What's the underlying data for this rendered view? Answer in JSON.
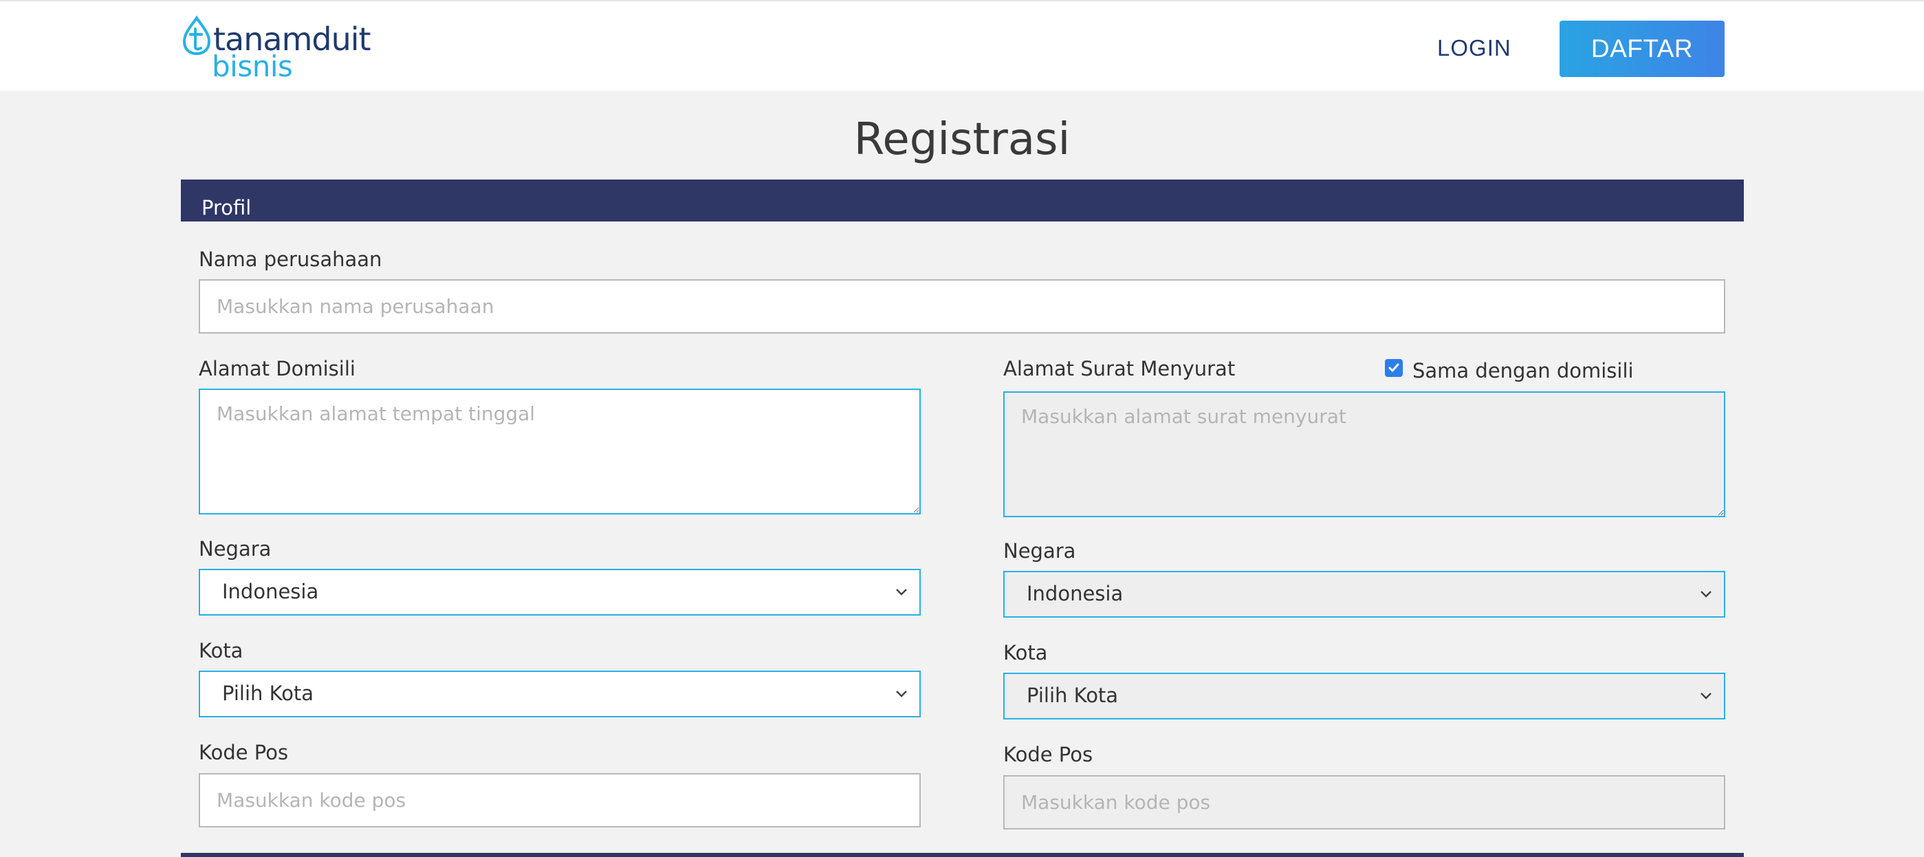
{
  "header": {
    "logo_line1": "tanamduit",
    "logo_line2": "bisnis",
    "login_label": "LOGIN",
    "daftar_label": "DAFTAR"
  },
  "page_title": "Registrasi",
  "section": {
    "title": "Profil"
  },
  "form": {
    "company": {
      "label": "Nama perusahaan",
      "placeholder": "Masukkan nama perusahaan"
    },
    "domicile": {
      "address_label": "Alamat Domisili",
      "address_placeholder": "Masukkan alamat tempat tinggal",
      "country_label": "Negara",
      "country_value": "Indonesia",
      "city_label": "Kota",
      "city_value": "Pilih Kota",
      "postal_label": "Kode Pos",
      "postal_placeholder": "Masukkan kode pos"
    },
    "mailing": {
      "address_label": "Alamat Surat Menyurat",
      "same_as_domicile_label": "Sama dengan domisili",
      "same_as_domicile_checked": true,
      "address_placeholder": "Masukkan alamat surat menyurat",
      "country_label": "Negara",
      "country_value": "Indonesia",
      "city_label": "Kota",
      "city_value": "Pilih Kota",
      "postal_label": "Kode Pos",
      "postal_placeholder": "Masukkan kode pos"
    }
  },
  "colors": {
    "brand_navy": "#1f3a6e",
    "brand_cyan": "#2ab0e6",
    "section_bar": "#2f3766",
    "daftar_gradient_start": "#2aa3e3",
    "daftar_gradient_end": "#3e84e6"
  },
  "icons": {
    "logo": "tanamduit-drop-logo-icon",
    "chevron": "chevron-down-icon",
    "check": "check-icon"
  }
}
